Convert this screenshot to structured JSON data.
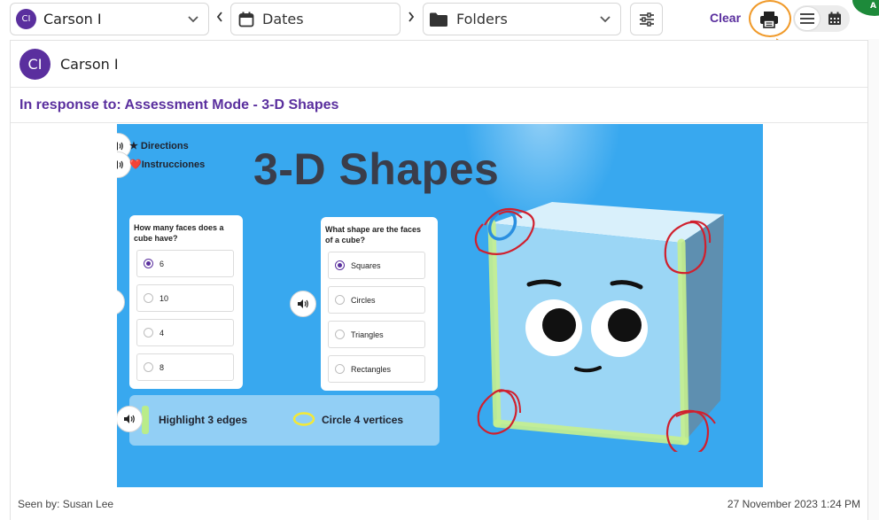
{
  "toolbar": {
    "student": {
      "initials": "CI",
      "name": "Carson I"
    },
    "dates_label": "Dates",
    "folders_label": "Folders",
    "clear_label": "Clear",
    "corner_badge": "A"
  },
  "card": {
    "author": {
      "initials": "CI",
      "name": "Carson I"
    },
    "response_title": "In response to: Assessment Mode - 3-D Shapes",
    "activity": {
      "title": "3-D Shapes",
      "directions": [
        {
          "icon": "star-icon",
          "label": "★ Directions"
        },
        {
          "icon": "heart-icon",
          "label": "❤️Instrucciones"
        }
      ],
      "question1": {
        "text": "How many faces does a cube have?",
        "options": [
          "6",
          "10",
          "4",
          "8"
        ],
        "selected_index": 0
      },
      "question2": {
        "text": "What shape are the faces of a cube?",
        "options": [
          "Squares",
          "Circles",
          "Triangles",
          "Rectangles"
        ],
        "selected_index": 0
      },
      "tasks": {
        "edges": "Highlight 3 edges",
        "vertices": "Circle 4 vertices"
      }
    },
    "footer": {
      "seen_by": "Seen by: Susan Lee",
      "timestamp": "27 November 2023 1:24 PM"
    }
  },
  "colors": {
    "brand_purple": "#5a2f9e",
    "activity_bg": "#38a8ef",
    "annotation_orange": "#f09a2a",
    "ink_red": "#d0202e",
    "ink_blue": "#2a8fe0"
  }
}
